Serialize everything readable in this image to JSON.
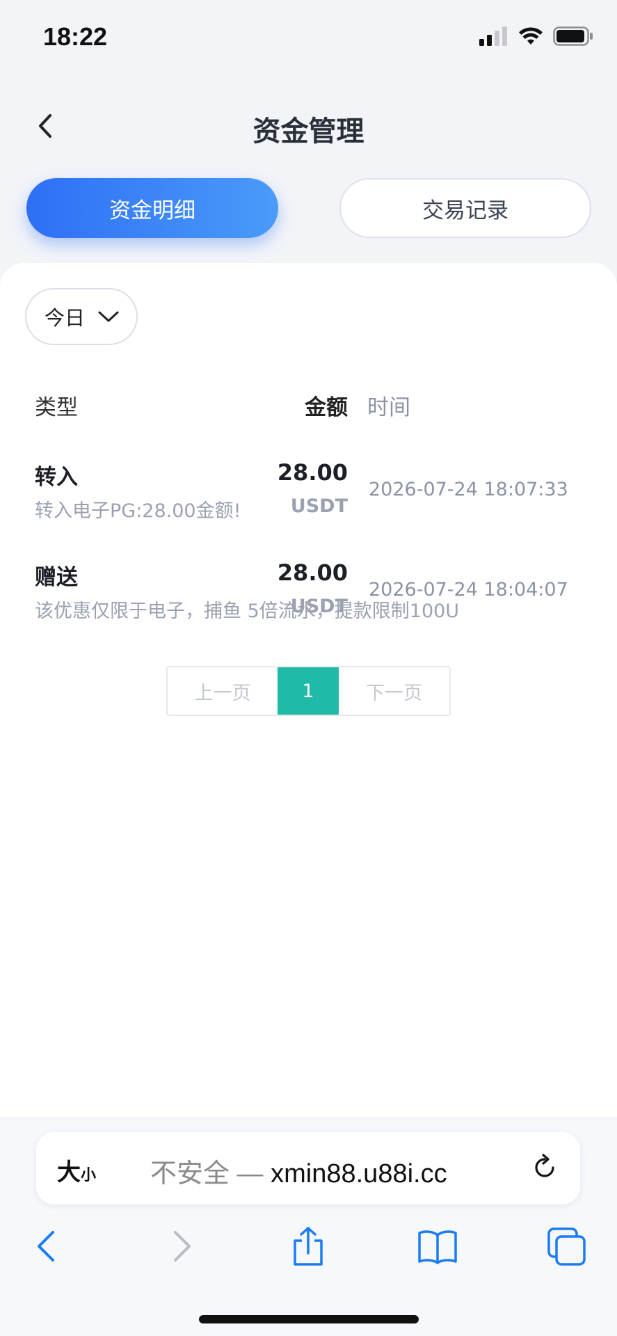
{
  "status_bar": {
    "time": "18:22"
  },
  "header": {
    "title": "资金管理"
  },
  "tabs": [
    {
      "label": "资金明细",
      "active": true
    },
    {
      "label": "交易记录",
      "active": false
    }
  ],
  "filter": {
    "selected": "今日"
  },
  "table": {
    "columns": {
      "type": "类型",
      "amount": "金额",
      "time": "时间"
    },
    "rows": [
      {
        "type": "转入",
        "desc": "转入电子PG:28.00金额!",
        "amount": "28.00",
        "unit": "USDT",
        "time": "2026-07-24 18:07:33"
      },
      {
        "type": "赠送",
        "desc": "该优惠仅限于电子，捕鱼 5倍流水，提款限制100U",
        "amount": "28.00",
        "unit": "USDT",
        "time": "2026-07-24 18:04:07"
      }
    ]
  },
  "pagination": {
    "prev": "上一页",
    "current": "1",
    "next": "下一页"
  },
  "browser": {
    "text_size_big": "大",
    "text_size_small": "小",
    "url_insecure": "不安全 — ",
    "url_domain": "xmin88.u88i.cc"
  },
  "colors": {
    "accent_gradient_start": "#2e6ff5",
    "accent_gradient_end": "#4a9bf9",
    "page_active": "#1fbba6",
    "ios_blue": "#1a7cf5"
  }
}
